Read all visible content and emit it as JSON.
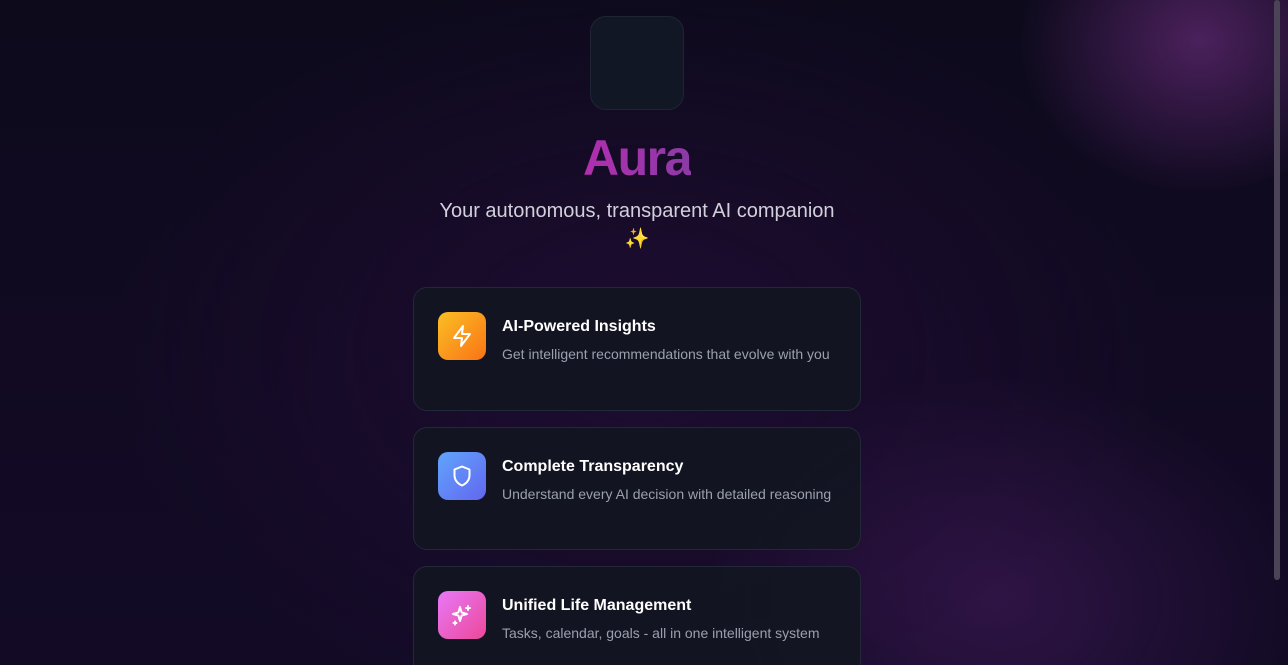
{
  "app": {
    "title": "Aura",
    "tagline": "Your autonomous, transparent AI companion",
    "tagline_emoji": "✨"
  },
  "features": [
    {
      "title": "AI-Powered Insights",
      "description": "Get intelligent recommendations that evolve with you",
      "icon": "lightning-icon",
      "color": "#f59e0b"
    },
    {
      "title": "Complete Transparency",
      "description": "Understand every AI decision with detailed reasoning",
      "icon": "shield-icon",
      "color": "#6366f1"
    },
    {
      "title": "Unified Life Management",
      "description": "Tasks, calendar, goals - all in one intelligent system",
      "icon": "sparkles-icon",
      "color": "#ec4899"
    }
  ],
  "colors": {
    "brand": "#a63aa9",
    "background": "#0f0b20",
    "card": "#121622"
  }
}
